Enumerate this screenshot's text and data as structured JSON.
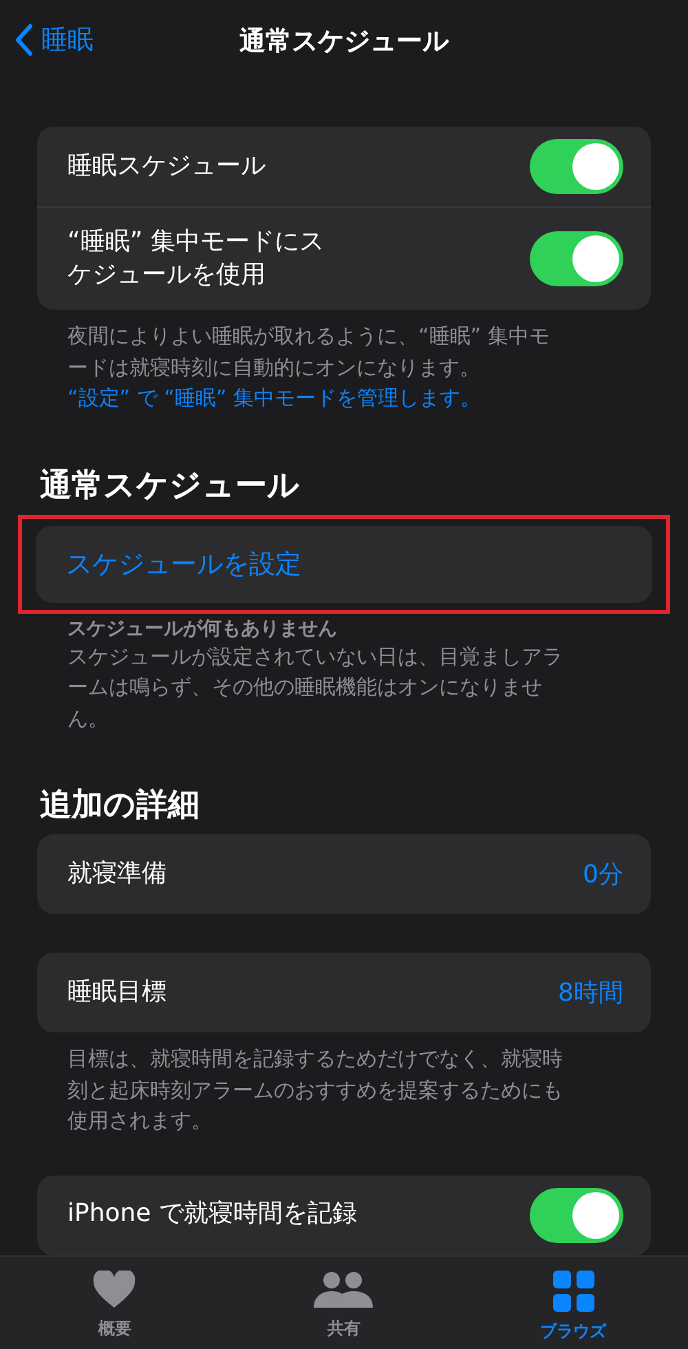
{
  "nav": {
    "back_label": "睡眠",
    "title": "通常スケジュール"
  },
  "toggle_group": {
    "rows": [
      {
        "label": "睡眠スケジュール",
        "on": true
      },
      {
        "label": "“睡眠” 集中モードにスケジュールを使用",
        "on": true
      }
    ],
    "note": "夜間によりよい睡眠が取れるように、“睡眠” 集中モードは就寝時刻に自動的にオンになります。",
    "note_link": "“設定” で “睡眠” 集中モードを管理します。"
  },
  "schedule_section": {
    "heading": "通常スケジュール",
    "button": "スケジュールを設定",
    "highlighted": true,
    "empty_title": "スケジュールが何もありません",
    "empty_text": "スケジュールが設定されていない日は、目覚ましアラームは鳴らず、その他の睡眠機能はオンになりません。"
  },
  "details_section": {
    "heading": "追加の詳細",
    "wind_down": {
      "label": "就寝準備",
      "value": "0分"
    },
    "sleep_goal": {
      "label": "睡眠目標",
      "value": "8時間"
    },
    "goal_note": "目標は、就寝時間を記録するためだけでなく、就寝時刻と起床時刻アラームのおすすめを提案するためにも使用されます。",
    "track": {
      "label": "iPhone で就寝時間を記録",
      "on": true
    }
  },
  "tab_bar": [
    {
      "kind": "heart",
      "label": "概要",
      "selected": false
    },
    {
      "kind": "people",
      "label": "共有",
      "selected": false
    },
    {
      "kind": "grid",
      "label": "ブラウズ",
      "selected": true
    }
  ]
}
